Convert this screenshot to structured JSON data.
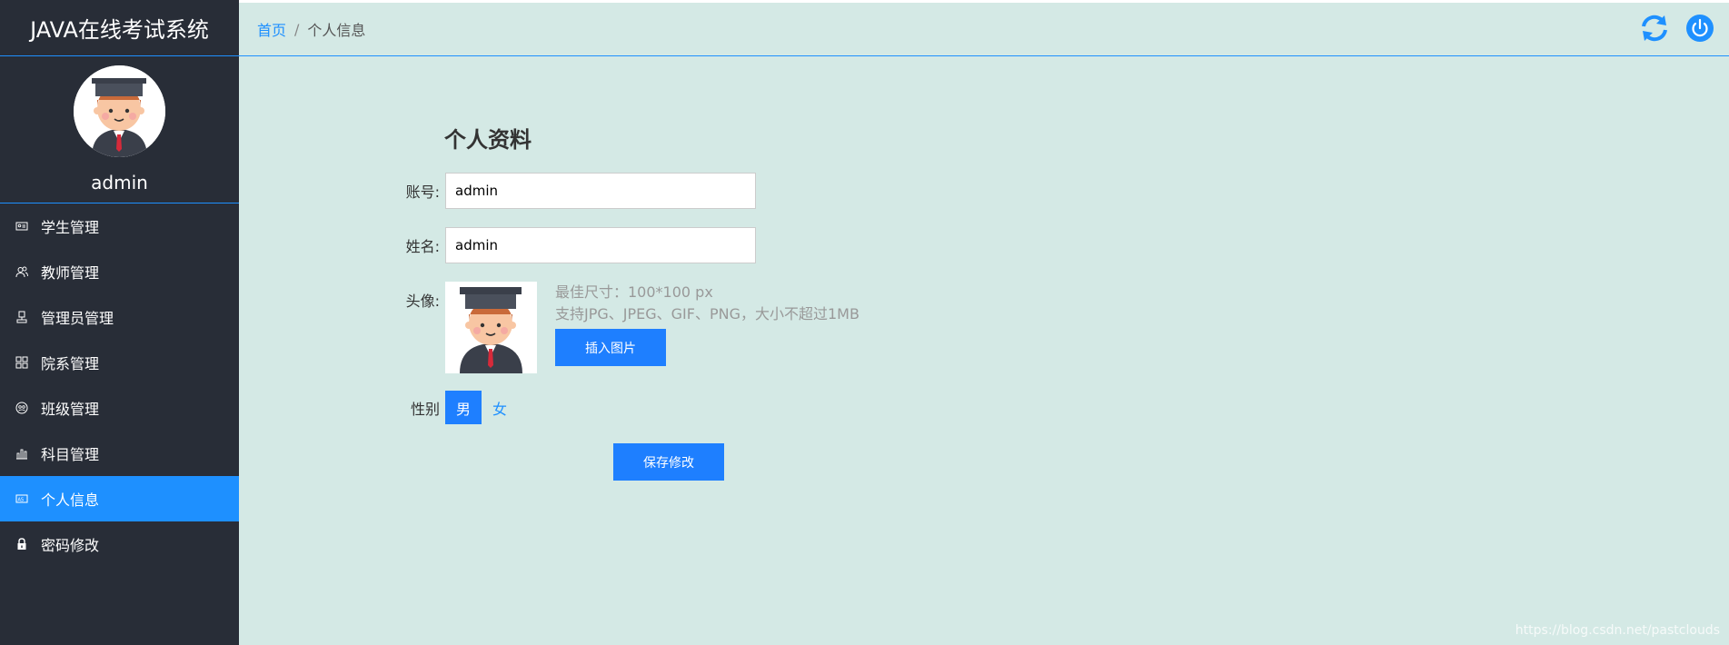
{
  "app": {
    "title": "JAVA在线考试系统"
  },
  "user": {
    "name": "admin"
  },
  "sidebar": {
    "items": [
      {
        "label": "学生管理",
        "icon": "id-card-icon",
        "active": false
      },
      {
        "label": "教师管理",
        "icon": "users-icon",
        "active": false
      },
      {
        "label": "管理员管理",
        "icon": "admin-icon",
        "active": false
      },
      {
        "label": "院系管理",
        "icon": "grid-icon",
        "active": false
      },
      {
        "label": "班级管理",
        "icon": "class-icon",
        "active": false
      },
      {
        "label": "科目管理",
        "icon": "chart-icon",
        "active": false
      },
      {
        "label": "个人信息",
        "icon": "profile-card-icon",
        "active": true
      },
      {
        "label": "密码修改",
        "icon": "lock-icon",
        "active": false
      }
    ]
  },
  "breadcrumb": {
    "home": "首页",
    "separator": "/",
    "current": "个人信息"
  },
  "header": {
    "refresh_icon": "refresh-icon",
    "power_icon": "power-icon"
  },
  "form": {
    "title": "个人资料",
    "account_label": "账号:",
    "account_value": "admin",
    "name_label": "姓名:",
    "name_value": "admin",
    "avatar_label": "头像:",
    "avatar_hint_size": "最佳尺寸：100*100 px",
    "avatar_hint_format": "支持JPG、JPEG、GIF、PNG，大小不超过1MB",
    "insert_image_label": "插入图片",
    "gender_label": "性别",
    "gender_male": "男",
    "gender_female": "女",
    "gender_selected": "男",
    "save_label": "保存修改"
  },
  "watermark": "https://blog.csdn.net/pastclouds",
  "colors": {
    "sidebar_bg": "#282d37",
    "accent": "#1e90ff",
    "content_bg": "#d4e9e5",
    "button": "#1e7fff"
  }
}
